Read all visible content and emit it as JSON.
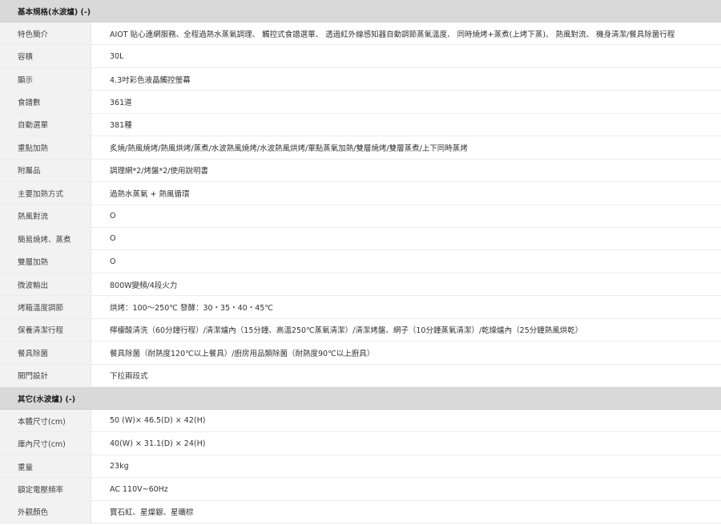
{
  "sections": [
    {
      "title": "基本規格(水波爐) (-)",
      "rows": [
        {
          "label": "特色簡介",
          "value": "AIOT 貼心連網服務、全程過熱水蒸氣調理、 觸控式食譜選單、 透過紅外線感知器自動調節蒸氣溫度、 同時燒烤+蒸煮(上烤下蒸)、 熱風對流、 機身清潔/餐具除菌行程"
        },
        {
          "label": "容積",
          "value": "30L"
        },
        {
          "label": "顯示",
          "value": "4.3吋彩色液晶觸控螢幕"
        },
        {
          "label": "食譜數",
          "value": "361道"
        },
        {
          "label": "自動選單",
          "value": "381種"
        },
        {
          "label": "重點加熱",
          "value": "炙燒/熱風燒烤/熱風烘烤/蒸煮/水波熱風燒烤/水波熱風烘烤/單點蒸氣加熱/雙層燒烤/雙層蒸煮/上下同時蒸烤"
        },
        {
          "label": "附屬品",
          "value": "調理網*2/烤盤*2/使用說明書"
        },
        {
          "label": "主要加熱方式",
          "value": "過熱水蒸氣 + 熱風循環"
        },
        {
          "label": "熱風對流",
          "value": "O"
        },
        {
          "label": "簡易燒烤、蒸煮",
          "value": "O"
        },
        {
          "label": "雙層加熱",
          "value": "O"
        },
        {
          "label": "微波輸出",
          "value": "800W變頻/4段火力"
        },
        {
          "label": "烤箱溫度調節",
          "value": "烘烤：100～250℃ 發酵：30・35・40・45℃"
        },
        {
          "label": "保養清潔行程",
          "value": "檸檬酸清洗（60分鐘行程）/清潔爐內（15分鐘、高溫250℃蒸氣清潔）/清潔烤盤、網子（10分鐘蒸氣清潔）/乾燥爐內（25分鐘熱風烘乾）"
        },
        {
          "label": "餐具除菌",
          "value": "餐具除菌（耐熱度120℃以上餐具）/廚房用品類除菌（耐熱度90℃以上廚具）"
        },
        {
          "label": "開門設計",
          "value": "下拉兩段式"
        }
      ]
    },
    {
      "title": "其它(水波爐) (-)",
      "rows": [
        {
          "label": "本體尺寸(cm)",
          "value": "50 (W)× 46.5(D) × 42(H)"
        },
        {
          "label": "庫內尺寸(cm)",
          "value": "40(W) × 31.1(D) × 24(H)"
        },
        {
          "label": "重量",
          "value": "23kg"
        },
        {
          "label": "額定電壓頻率",
          "value": "AC 110V~60Hz"
        },
        {
          "label": "外觀顏色",
          "value": "寶石紅、星燦銀、星曠棕"
        }
      ]
    }
  ]
}
